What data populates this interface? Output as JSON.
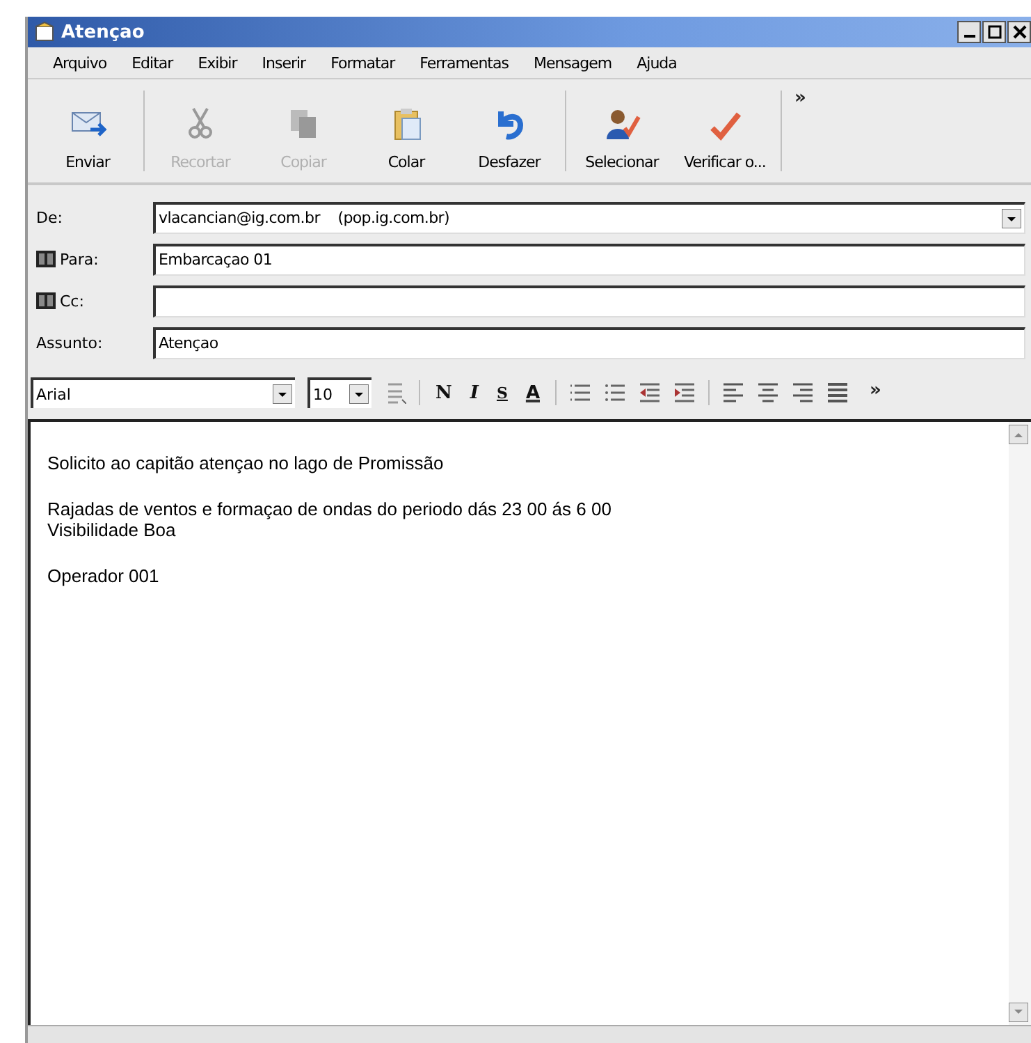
{
  "window": {
    "title": "Atençao"
  },
  "menu": [
    "Arquivo",
    "Editar",
    "Exibir",
    "Inserir",
    "Formatar",
    "Ferramentas",
    "Mensagem",
    "Ajuda"
  ],
  "toolbar": {
    "buttons": [
      {
        "label": "Enviar",
        "kind": "send",
        "disabled": false
      },
      {
        "kind": "separator"
      },
      {
        "label": "Recortar",
        "kind": "cut",
        "disabled": true
      },
      {
        "label": "Copiar",
        "kind": "copy",
        "disabled": true
      },
      {
        "label": "Colar",
        "kind": "paste",
        "disabled": false
      },
      {
        "label": "Desfazer",
        "kind": "undo",
        "disabled": false
      },
      {
        "kind": "separator"
      },
      {
        "label": "Selecionar",
        "kind": "select",
        "disabled": false
      },
      {
        "label": "Verificar o...",
        "kind": "check",
        "disabled": false
      },
      {
        "kind": "separator"
      }
    ],
    "more": "»"
  },
  "header_fields": [
    {
      "label": "De:",
      "kind": "dropdown",
      "value": "vlacancian@ig.com.br    (pop.ig.com.br)",
      "address_book": false
    },
    {
      "label": "Para:",
      "kind": "text",
      "value": "Embarcaçao 01",
      "address_book": true
    },
    {
      "label": "Cc:",
      "kind": "text",
      "address_book": true
    },
    {
      "label": "Assunto:",
      "kind": "text",
      "value": "Atençao",
      "address_book": false
    }
  ],
  "format_bar": {
    "font": "Arial",
    "size": "10",
    "buttons": [
      {
        "kind": "paragraph"
      },
      {
        "kind": "separator"
      },
      {
        "kind": "bold",
        "label": "N"
      },
      {
        "kind": "italic",
        "label": "I"
      },
      {
        "kind": "underline",
        "label": "S"
      },
      {
        "kind": "font-color",
        "label": "A"
      },
      {
        "kind": "separator"
      },
      {
        "kind": "numbered-list"
      },
      {
        "kind": "bullet-list"
      },
      {
        "kind": "outdent"
      },
      {
        "kind": "indent"
      },
      {
        "kind": "separator"
      },
      {
        "kind": "align-left"
      },
      {
        "kind": "align-center"
      },
      {
        "kind": "align-right"
      },
      {
        "kind": "justify"
      }
    ],
    "more": "»"
  },
  "body": {
    "paragraphs": [
      {
        "lines": [
          "Solicito ao capitão atençao no lago de Promissão"
        ]
      },
      {
        "lines": [
          "Rajadas de ventos e formaçao de ondas do periodo dás 23 00 ás 6 00",
          "Visibilidade Boa"
        ]
      },
      {
        "lines": [
          "Operador 001"
        ]
      }
    ]
  }
}
